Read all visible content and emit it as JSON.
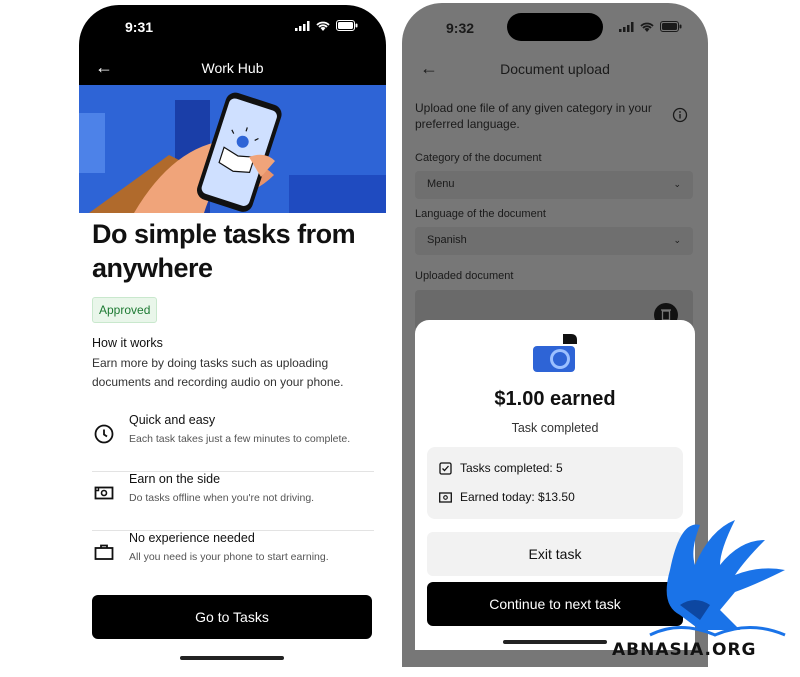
{
  "phone1": {
    "status_time": "9:31",
    "header_title": "Work Hub",
    "headline": "Do simple tasks from anywhere",
    "badge": "Approved",
    "how_title": "How it works",
    "how_desc": "Earn more by doing tasks such as uploading documents and recording audio on your phone.",
    "features": [
      {
        "icon": "clock-icon",
        "title": "Quick and easy",
        "desc": "Each task takes just a few minutes to complete."
      },
      {
        "icon": "cash-icon",
        "title": "Earn on the side",
        "desc": "Do tasks offline when you're not driving."
      },
      {
        "icon": "briefcase-icon",
        "title": "No experience needed",
        "desc": "All you need is your phone to start earning."
      }
    ],
    "cta": "Go to Tasks"
  },
  "phone2": {
    "status_time": "9:32",
    "header_title": "Document upload",
    "intro": "Upload one file of any given category in your preferred language.",
    "category_label": "Category of the document",
    "category_value": "Menu",
    "language_label": "Language of the document",
    "language_value": "Spanish",
    "uploaded_label": "Uploaded document",
    "sheet": {
      "earned": "$1.00 earned",
      "subtitle": "Task completed",
      "stats": [
        {
          "icon": "checklist-icon",
          "text": "Tasks completed: 5"
        },
        {
          "icon": "cash-icon",
          "text": "Earned today: $13.50"
        }
      ],
      "exit_button": "Exit task",
      "continue_button": "Continue to next task"
    }
  },
  "watermark": {
    "text": "ABNASIA.ORG"
  },
  "colors": {
    "hero_blue": "#2e64d6",
    "approved_green": "#1d7a33",
    "overlay_gray": "#777777",
    "watermark_blue": "#1a73e8"
  }
}
